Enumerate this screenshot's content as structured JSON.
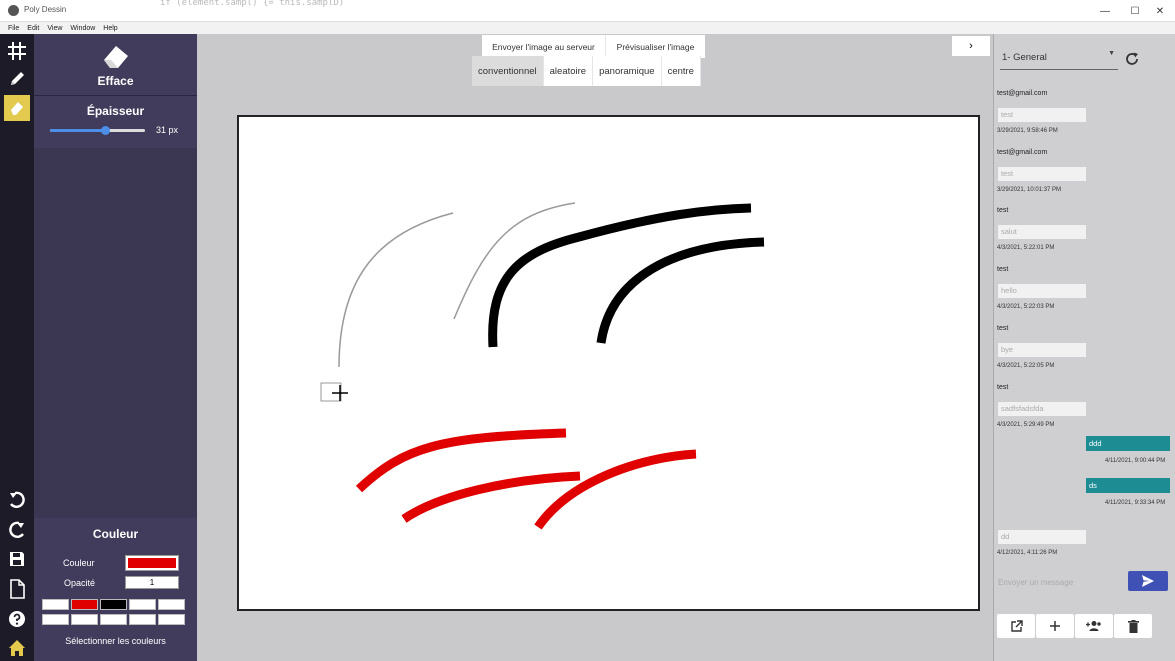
{
  "window": {
    "title": "Poly Dessin",
    "code_overlay": "if (element.sampl) {= this.samplD)",
    "minimize": "—",
    "maximize": "☐",
    "close": "✕"
  },
  "menu": [
    "File",
    "Edit",
    "View",
    "Window",
    "Help"
  ],
  "rail": {
    "icons": [
      "grid-icon",
      "pencil-icon",
      "eraser-icon",
      "undo-icon",
      "redo-icon",
      "save-icon",
      "new-file-icon",
      "help-icon",
      "home-icon"
    ],
    "active": "eraser-icon"
  },
  "tool": {
    "name": "Efface",
    "thickness_title": "Épaisseur",
    "thickness_value": "31 px",
    "thickness_fraction": 0.58
  },
  "color": {
    "title": "Couleur",
    "color_label": "Couleur",
    "opacity_label": "Opacité",
    "opacity_value": "1",
    "current": "#e00000",
    "palette": [
      "#ffffff",
      "#e00000",
      "#000000",
      "#ffffff",
      "#ffffff",
      "#ffffff",
      "#ffffff",
      "#ffffff",
      "#ffffff",
      "#ffffff"
    ],
    "select_label": "Sélectionner les couleurs"
  },
  "workspace": {
    "send_image": "Envoyer l'image au serveur",
    "preview_image": "Prévisualiser l'image",
    "modes": [
      "conventionnel",
      "aleatoire",
      "panoramique",
      "centre"
    ],
    "active_mode": "conventionnel",
    "collapse_glyph": "›"
  },
  "chat": {
    "channel": "1- General",
    "caret": "▼",
    "messages": [
      {
        "user": "test@gmail.com",
        "text": "test",
        "time": "3/29/2021, 9:58:46 PM"
      },
      {
        "user": "test@gmail.com",
        "text": "test",
        "time": "3/29/2021, 10:01:37 PM"
      },
      {
        "user": "test",
        "text": "salut",
        "time": "4/3/2021, 5:22:01 PM"
      },
      {
        "user": "test",
        "text": "hello",
        "time": "4/3/2021, 5:22:03 PM"
      },
      {
        "user": "test",
        "text": "bye",
        "time": "4/3/2021, 5:22:05 PM"
      },
      {
        "user": "test",
        "text": "sadfsfadsfda",
        "time": "4/3/2021, 5:29:49 PM"
      }
    ],
    "own_messages": [
      {
        "text": "ddd",
        "time": "4/11/2021, 9:00:44 PM"
      },
      {
        "text": "ds",
        "time": "4/11/2021, 9:33:34 PM"
      }
    ],
    "last_message": {
      "text": "dd",
      "time": "4/12/2021, 4:11:26 PM"
    },
    "input_placeholder": "Envoyer un message",
    "accent": "#3f51b5",
    "own_bubble_color": "#1d8c93"
  }
}
